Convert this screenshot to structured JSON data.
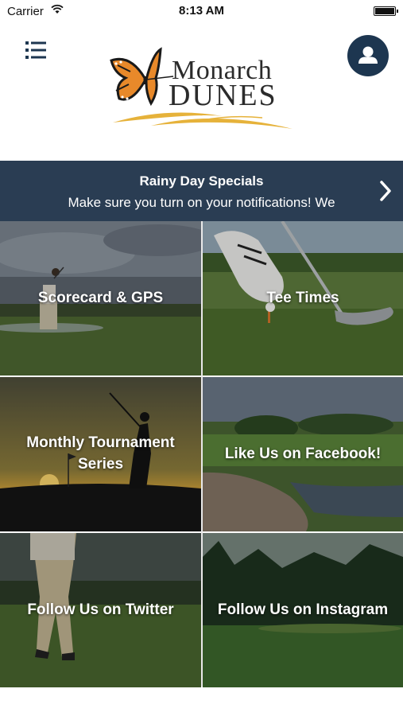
{
  "status_bar": {
    "carrier": "Carrier",
    "time": "8:13 AM"
  },
  "header": {
    "logo_line1": "Monarch",
    "logo_line2": "DUNES",
    "menu_icon": "hamburger-list-icon",
    "profile_icon": "user-icon"
  },
  "banner": {
    "title": "Rainy Day Specials",
    "subtitle": "Make sure you turn on your notifications! We",
    "chevron_icon": "chevron-right-icon"
  },
  "tiles": [
    {
      "label": "Scorecard & GPS"
    },
    {
      "label": "Tee Times"
    },
    {
      "label": "Monthly Tournament Series"
    },
    {
      "label": "Like Us on Facebook!"
    },
    {
      "label": "Follow Us on Twitter"
    },
    {
      "label": "Follow Us on Instagram"
    }
  ],
  "colors": {
    "navy": "#1d3650",
    "banner": "#2a3d53",
    "logo_gold": "#e6b23a",
    "butterfly_orange": "#e8892a"
  }
}
